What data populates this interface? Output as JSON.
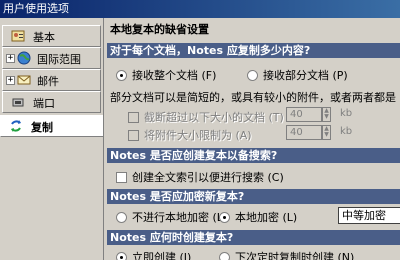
{
  "window": {
    "title": "用户使用选项"
  },
  "sidebar": {
    "items": [
      {
        "label": "基本",
        "icon": "person-card-icon",
        "expandable": false,
        "selected": false
      },
      {
        "label": "国际范围",
        "icon": "globe-icon",
        "expandable": true,
        "selected": false
      },
      {
        "label": "邮件",
        "icon": "mail-icon",
        "expandable": true,
        "selected": false
      },
      {
        "label": "端口",
        "icon": "port-icon",
        "expandable": false,
        "selected": false
      },
      {
        "label": "复制",
        "icon": "replication-icon",
        "expandable": false,
        "selected": true
      }
    ],
    "expand_glyph": "+"
  },
  "main": {
    "page_title": "本地复本的缺省设置",
    "sections": {
      "content": {
        "heading": "对于每个文档，Notes 应复制多少内容?",
        "full_label": "接收整个文档 (F)",
        "partial_label": "接收部分文档 (P)",
        "note": "部分文档可以是简短的，或具有较小的附件，或者两者都是",
        "truncate_label": "截断超过以下大小的文档 (T)",
        "truncate_value": "40",
        "truncate_unit": "kb",
        "attach_label": "将附件大小限制为 (A)",
        "attach_value": "40",
        "attach_unit": "kb"
      },
      "index": {
        "heading": "Notes 是否应创建复本以备搜索?",
        "check_label": "创建全文索引以便进行搜索 (C)"
      },
      "encrypt": {
        "heading": "Notes 是否应加密新复本?",
        "no_label": "不进行本地加密 (L)",
        "yes_label": "本地加密 (L)",
        "level_value": "中等加密"
      },
      "schedule": {
        "heading": "Notes 应何时创建复本?",
        "now_label": "立即创建 (I)",
        "later_label": "下次定时复制时创建 (N)"
      }
    }
  },
  "colors": {
    "band": "#4a5e88",
    "titlebar": "#0a246a",
    "face": "#d4d0c8"
  }
}
